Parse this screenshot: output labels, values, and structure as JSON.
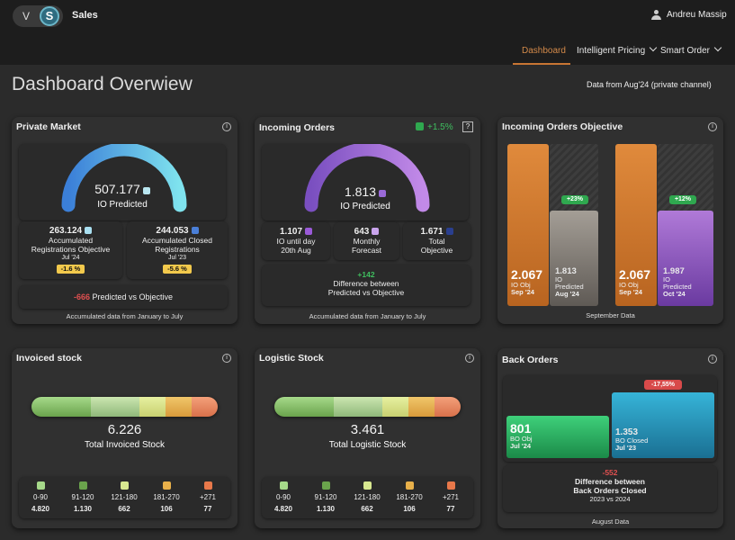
{
  "app": {
    "title": "Sales",
    "user": "Andreu Massip",
    "logo_left": "V",
    "logo_right": "S"
  },
  "nav": {
    "dashboard": "Dashboard",
    "intelligent_pricing": "Intelligent Pricing",
    "smart_order": "Smart Order"
  },
  "page": {
    "title": "Dashboard Overwiew",
    "data_range": "Data  from Aug'24 (private channel)"
  },
  "private_market": {
    "title": "Private Market",
    "gauge_value": "507.177",
    "gauge_label": "IO Predicted",
    "gauge_fill": 0.85,
    "stat1": {
      "value": "263.124",
      "label1": "Accumulated",
      "label2": "Registrations Objective",
      "date": "Jul '24",
      "badge": "-1.6 %"
    },
    "stat2": {
      "value": "244.053",
      "label1": "Accumulated Closed",
      "label2": "Registrations",
      "date": "Jul '23",
      "badge": "-5.6 %"
    },
    "diff_value": "-666",
    "diff_label": "Predicted vs Objective",
    "footer": "Accumulated data from January to July"
  },
  "incoming_orders": {
    "title": "Incoming Orders",
    "change": "+1.5%",
    "help": "?",
    "gauge_value": "1.813",
    "gauge_label": "IO Predicted",
    "gauge_fill": 0.9,
    "stat1": {
      "value": "1.107",
      "label1": "IO until day",
      "label2": "20th Aug"
    },
    "stat2": {
      "value": "643",
      "label1": "Monthly",
      "label2": "Forecast"
    },
    "stat3": {
      "value": "1.671",
      "label1": "Total",
      "label2": "Objective"
    },
    "diff_value": "+142",
    "diff_label1": "Difference between",
    "diff_label2": "Predicted vs Objective",
    "footer": "Accumulated data from January to July"
  },
  "io_objective": {
    "title": "Incoming Orders Objective",
    "footer": "September Data",
    "group1": {
      "obj_value": "2.067",
      "obj_label": "IO Obj",
      "obj_date": "Sep '24",
      "pred_value": "1.813",
      "pred_label1": "IO",
      "pred_label2": "Predicted",
      "pred_date": "Aug '24",
      "change": "+23%",
      "obj_fill": 1.0,
      "pred_fill": 0.88
    },
    "group2": {
      "obj_value": "2.067",
      "obj_label": "IO Obj",
      "obj_date": "Sep '24",
      "pred_value": "1.987",
      "pred_label1": "IO",
      "pred_label2": "Predicted",
      "pred_date": "Oct '24",
      "change": "+12%",
      "obj_fill": 1.0,
      "pred_fill": 0.96
    }
  },
  "invoiced_stock": {
    "title": "Invoiced stock",
    "total": "6.226",
    "label": "Total Invoiced Stock",
    "buckets": [
      {
        "range": "0-90",
        "value": "4.820"
      },
      {
        "range": "91-120",
        "value": "1.130"
      },
      {
        "range": "121-180",
        "value": "662"
      },
      {
        "range": "181-270",
        "value": "106"
      },
      {
        "range": "+271",
        "value": "77"
      }
    ]
  },
  "logistic_stock": {
    "title": "Logistic Stock",
    "total": "3.461",
    "label": "Total Logistic Stock",
    "buckets": [
      {
        "range": "0-90",
        "value": "4.820"
      },
      {
        "range": "91-120",
        "value": "1.130"
      },
      {
        "range": "121-180",
        "value": "662"
      },
      {
        "range": "181-270",
        "value": "106"
      },
      {
        "range": "+271",
        "value": "77"
      }
    ]
  },
  "back_orders": {
    "title": "Back Orders",
    "change": "-17,55%",
    "bo_obj": {
      "value": "801",
      "label": "BO Obj",
      "date": "Jul '24"
    },
    "bo_closed": {
      "value": "1.353",
      "label": "BO Closed",
      "date": "Jul '23"
    },
    "diff_value": "-552",
    "diff_label1": "Difference between",
    "diff_label2": "Back Orders Closed",
    "diff_label3": "2023 vs 2024",
    "footer": "August Data"
  },
  "colors": {
    "accent": "#c87533",
    "green": "#2fa84f",
    "red": "#e05050",
    "badge": "#f2c94c",
    "buckets": [
      "#8fc46a",
      "#6aa34c",
      "#c8e08a",
      "#e8b04a",
      "#e8784a"
    ]
  }
}
